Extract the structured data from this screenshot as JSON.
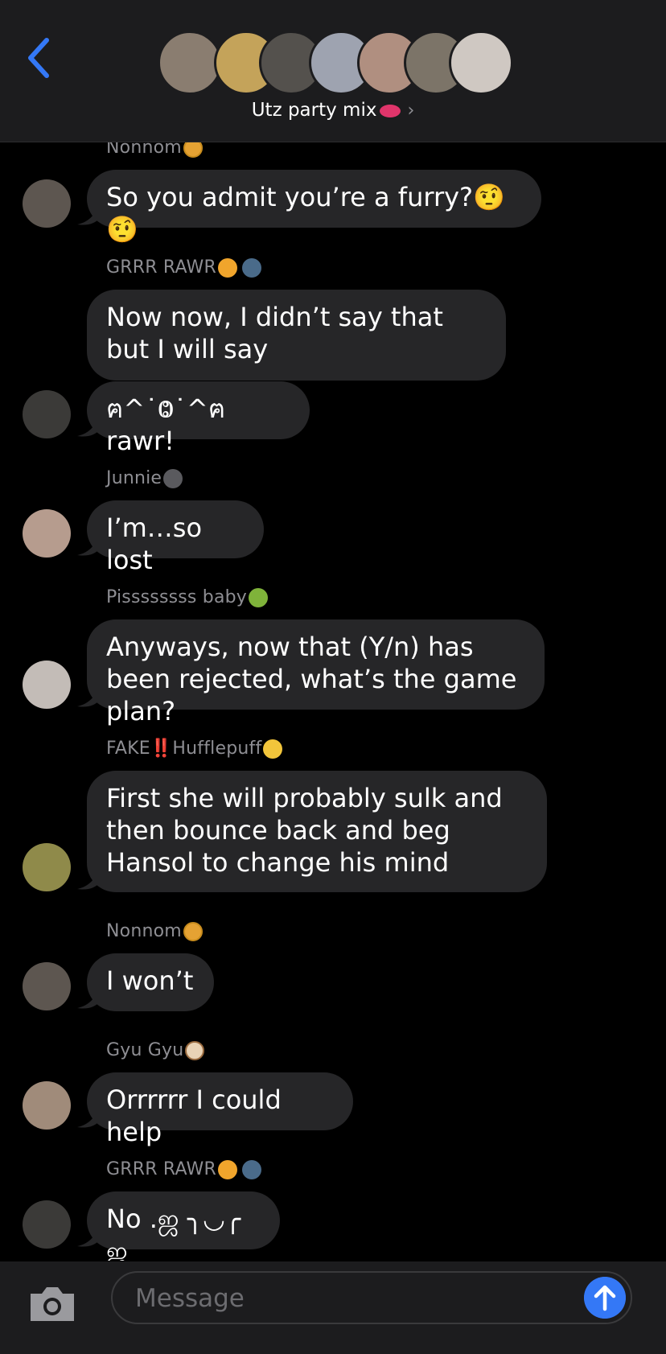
{
  "header": {
    "title": "Utz party mix",
    "title_emoji_icon": "lips-icon",
    "back_icon": "chevron-left-icon",
    "participants": [
      {
        "color": "#8a7d70"
      },
      {
        "color": "#c4a35a"
      },
      {
        "color": "#54514d"
      },
      {
        "color": "#9ea3b0"
      },
      {
        "color": "#b08f80"
      },
      {
        "color": "#7c7468"
      },
      {
        "color": "#cfc8c2"
      }
    ]
  },
  "messages": [
    {
      "sender": "Nonnom",
      "sender_emoji": "neutral-face-icon",
      "text": "So you admit you’re a furry?🤨 🤨",
      "avatar_color": "#5d5650"
    },
    {
      "sender": "GRRR RAWR",
      "sender_emoji": "tiger-face-icon speaking-head-icon",
      "text": "Now now, I didn’t say that but I will say",
      "avatar_color": "#3b3a38"
    },
    {
      "sender": "",
      "text": "ฅ^˙Ⱉ˙^ฅ rawr!",
      "avatar_color": "#3b3a38"
    },
    {
      "sender": "Junnie",
      "sender_emoji": "paw-prints-icon",
      "text": "I’m…so lost",
      "avatar_color": "#b69c8e"
    },
    {
      "sender": "Pissssssss baby",
      "sender_emoji": "snake-icon",
      "text": "Anyways, now that (Y/n) has been rejected, what’s the game plan?",
      "avatar_color": "#c3bcb7"
    },
    {
      "sender": "FAKE‼️Hufflepuff",
      "sender_emoji": "sparkles-icon",
      "text": "First she will probably sulk and then bounce back and beg Hansol to change his mind",
      "avatar_color": "#8f8a4a"
    },
    {
      "sender": "Nonnom",
      "sender_emoji": "neutral-face-icon",
      "text": "I won’t",
      "avatar_color": "#5d5650"
    },
    {
      "sender": "Gyu Gyu",
      "sender_emoji": "dog-face-icon",
      "text": "Orrrrrr I could help",
      "avatar_color": "#a08b7a"
    },
    {
      "sender": "GRRR RAWR",
      "sender_emoji": "tiger-face-icon speaking-head-icon",
      "text": "No .ஜ ╮◡╭ ஜ",
      "avatar_color": "#3b3a38"
    }
  ],
  "composer": {
    "placeholder": "Message",
    "camera_icon": "camera-icon",
    "send_icon": "arrow-up-icon"
  },
  "colors": {
    "accent": "#3478f6",
    "bubble": "#262628",
    "header": "#1c1c1e"
  }
}
